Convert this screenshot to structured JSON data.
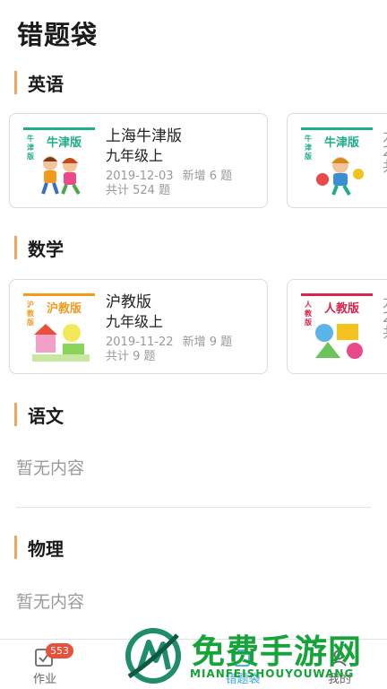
{
  "header": {
    "title": "错题袋"
  },
  "sections": {
    "english": {
      "label": "英语",
      "cards": [
        {
          "name": "上海牛津版",
          "grade": "九年级上",
          "date": "2019-12-03",
          "new": "新增 6 题",
          "total": "共计 524 题",
          "cover_title": "牛津版",
          "cover_side": "牛津版",
          "accent": "#1fae8a"
        },
        {
          "cover_title": "牛津版",
          "cover_side": "牛津版",
          "peek_lines": [
            "九",
            "2",
            "共"
          ],
          "accent": "#1fae8a"
        }
      ]
    },
    "math": {
      "label": "数学",
      "cards": [
        {
          "name": "沪教版",
          "grade": "九年级上",
          "date": "2019-11-22",
          "new": "新增 9 题",
          "total": "共计 9 题",
          "cover_title": "沪教版",
          "cover_side": "沪教版",
          "accent": "#f29a1e"
        },
        {
          "cover_title": "人教版",
          "cover_side": "人教版",
          "peek_lines": [
            "九",
            "2",
            "共"
          ],
          "accent": "#d9254b"
        }
      ]
    },
    "chinese": {
      "label": "语文",
      "empty": "暂无内容"
    },
    "physics": {
      "label": "物理",
      "empty": "暂无内容"
    }
  },
  "bottom_nav": [
    {
      "label": "作业",
      "icon": "homework-icon",
      "badge": "553"
    },
    {
      "label": "",
      "icon": "book-icon"
    },
    {
      "label": "错题袋",
      "icon": "mistake-bag-icon"
    },
    {
      "label": "我的",
      "icon": "profile-icon"
    }
  ],
  "watermark": {
    "title": "免费手游网",
    "subtitle": "MIANFEISHOUYOUWANG"
  }
}
